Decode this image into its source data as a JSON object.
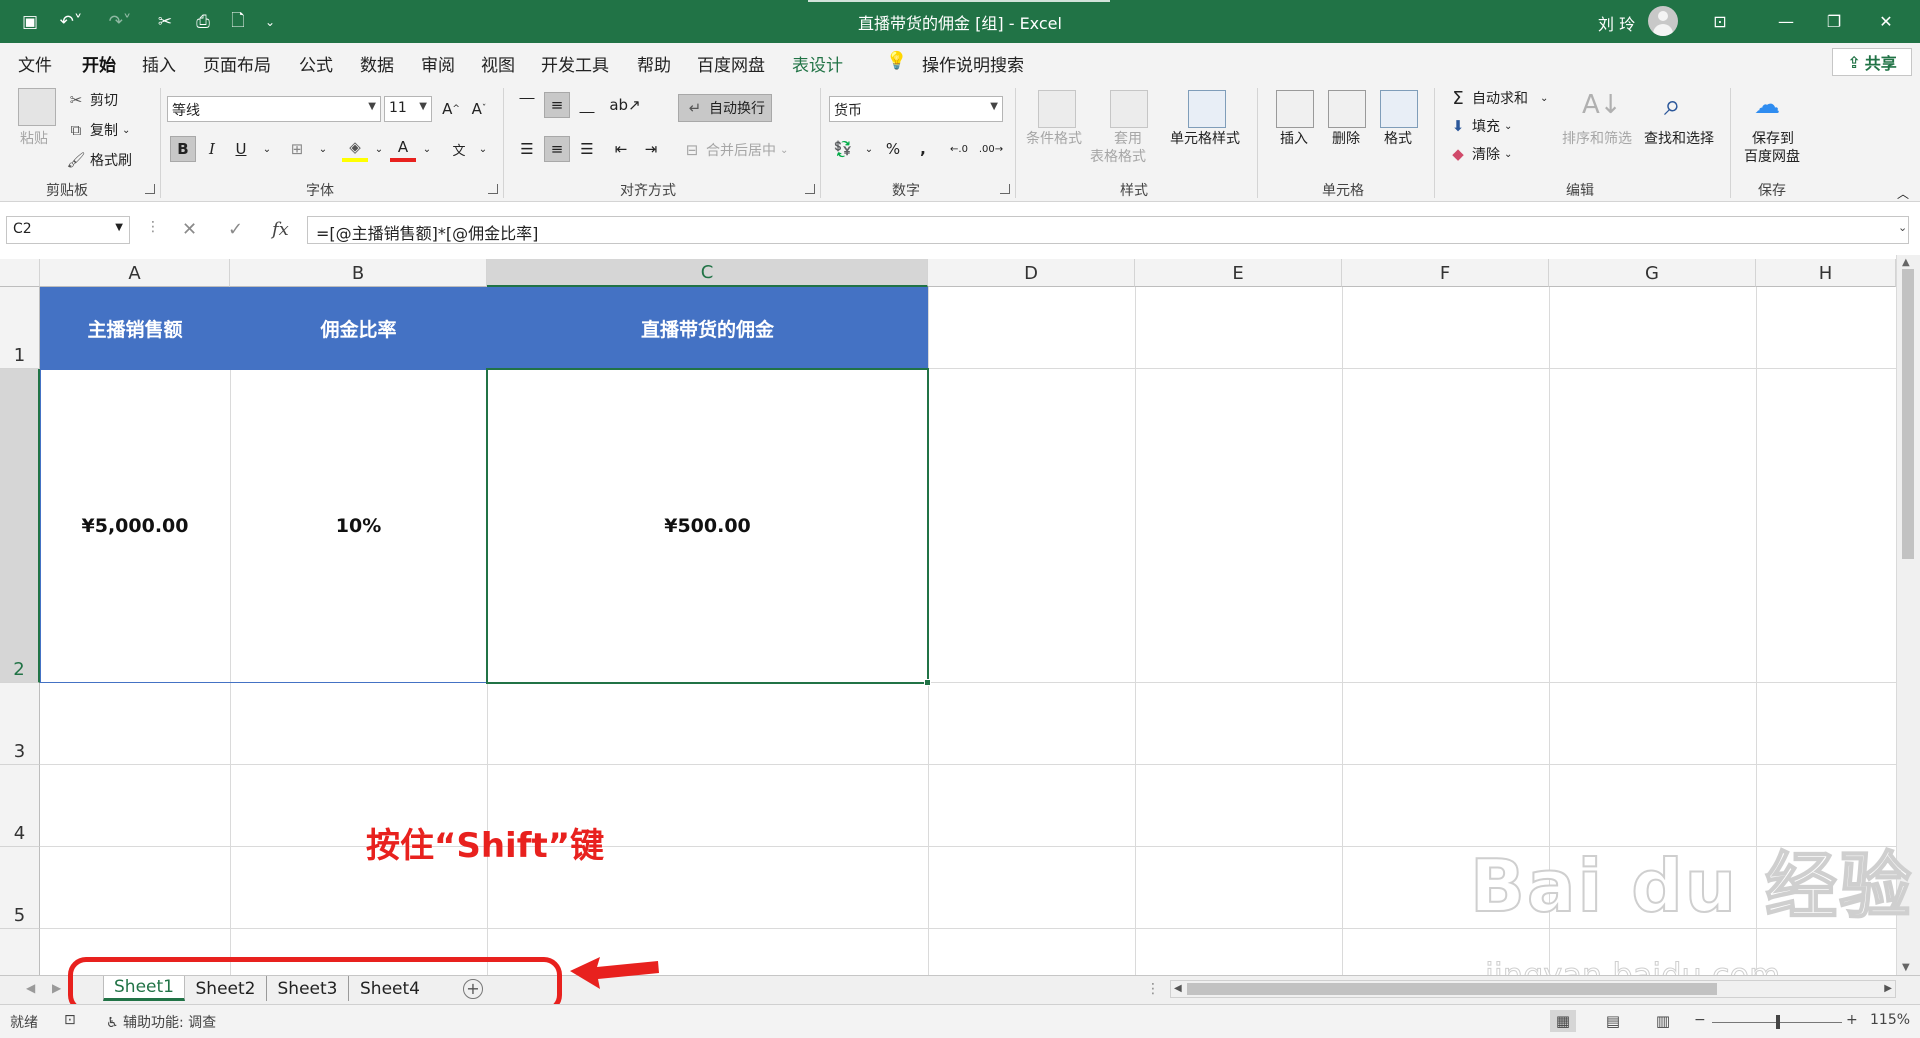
{
  "titlebar": {
    "title": "直播带货的佣金 [组] - Excel",
    "user": "刘 玲"
  },
  "tabs": [
    "文件",
    "开始",
    "插入",
    "页面布局",
    "公式",
    "数据",
    "审阅",
    "视图",
    "开发工具",
    "帮助",
    "百度网盘",
    "表设计"
  ],
  "active_tab": "开始",
  "tell_me": "操作说明搜索",
  "share": "共享",
  "ribbon": {
    "clipboard": {
      "paste": "粘贴",
      "cut": "剪切",
      "copy": "复制",
      "painter": "格式刷",
      "label": "剪贴板"
    },
    "font": {
      "name": "等线",
      "size": "11",
      "label": "字体"
    },
    "align": {
      "wrap": "自动换行",
      "merge": "合并后居中",
      "label": "对齐方式"
    },
    "number": {
      "format": "货币",
      "label": "数字"
    },
    "styles": {
      "cond": "条件格式",
      "table_1": "套用",
      "table_2": "表格格式",
      "cell": "单元格样式",
      "label": "样式"
    },
    "cells": {
      "insert": "插入",
      "delete": "删除",
      "format": "格式",
      "label": "单元格"
    },
    "editing": {
      "autosum": "自动求和",
      "fill": "填充",
      "clear": "清除",
      "sort": "排序和筛选",
      "find": "查找和选择",
      "label": "编辑"
    },
    "save": {
      "btn_1": "保存到",
      "btn_2": "百度网盘",
      "label": "保存"
    }
  },
  "formula_bar": {
    "namebox": "C2",
    "formula": "=[@主播销售额]*[@佣金比率]"
  },
  "columns": [
    "A",
    "B",
    "C",
    "D",
    "E",
    "F",
    "G",
    "H"
  ],
  "rows": [
    "1",
    "2",
    "3",
    "4",
    "5"
  ],
  "table": {
    "headers": [
      "主播销售额",
      "佣金比率",
      "直播带货的佣金"
    ],
    "row": [
      "¥5,000.00",
      "10%",
      "¥500.00"
    ]
  },
  "annotation": "按住“Shift”键",
  "sheets": [
    "Sheet1",
    "Sheet2",
    "Sheet3",
    "Sheet4"
  ],
  "active_sheet": "Sheet1",
  "status": {
    "ready": "就绪",
    "accessibility": "辅助功能: 调查",
    "zoom": "115%"
  },
  "watermark": {
    "main": "Bai du 经验",
    "sub": "jingyan.baidu.com"
  },
  "colors": {
    "excel_green": "#217346",
    "table_header": "#4472c4",
    "annotation": "#e8211e"
  }
}
